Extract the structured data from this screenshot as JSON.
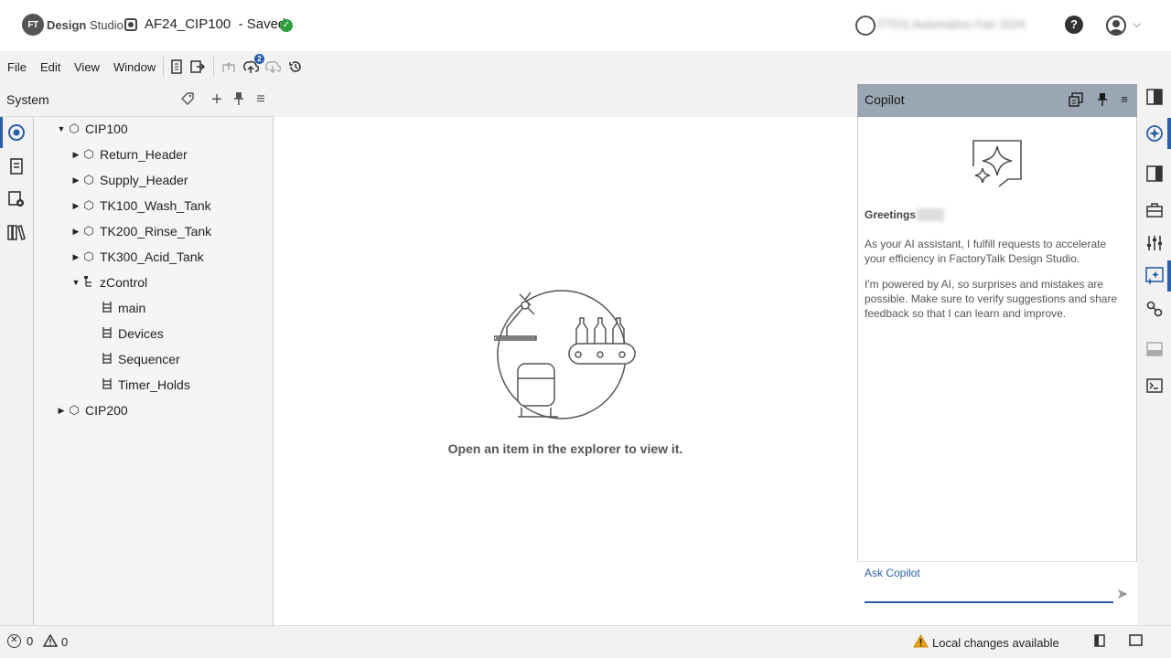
{
  "titlebar": {
    "logo_badge": "FT",
    "logo_bold": "Design",
    "logo_rest": " Studio",
    "project_name": "AF24_CIP100",
    "project_status": "- Saved",
    "workspace_name": "FTDS Automation Fair 2024",
    "help_glyph": "?",
    "user_menu_glyph": "⌵"
  },
  "menu": {
    "file": "File",
    "edit": "Edit",
    "view": "View",
    "window": "Window",
    "sync_badge": "2"
  },
  "system_panel": {
    "title": "System",
    "add_glyph": "+",
    "pin_glyph": "⊥",
    "menu_glyph": "≡"
  },
  "tree": {
    "cip100": "CIP100",
    "return_header": "Return_Header",
    "supply_header": "Supply_Header",
    "tk100": "TK100_Wash_Tank",
    "tk200": "TK200_Rinse_Tank",
    "tk300": "TK300_Acid_Tank",
    "zcontrol": "zControl",
    "main": "main",
    "devices": "Devices",
    "sequencer": "Sequencer",
    "timer_holds": "Timer_Holds",
    "cip200": "CIP200"
  },
  "main": {
    "empty_message": "Open an item in the explorer to view it."
  },
  "copilot": {
    "title": "Copilot",
    "greeting": "Greetings",
    "para1": "As your AI assistant, I fulfill requests to accelerate your efficiency in FactoryTalk Design Studio.",
    "para2": "I'm powered by AI, so surprises and mistakes are possible. Make sure to verify suggestions and share feedback so that I can learn and improve.",
    "input_label": "Ask Copilot",
    "input_value": "",
    "send_glyph": "➤"
  },
  "status": {
    "errors": "0",
    "warnings": "0",
    "local_changes": "Local changes available"
  },
  "colors": {
    "accent": "#2a5ea8",
    "copilot_header": "#9aa6b4",
    "saved_green": "#2e9e3e",
    "warning_yellow": "#e8a317"
  }
}
